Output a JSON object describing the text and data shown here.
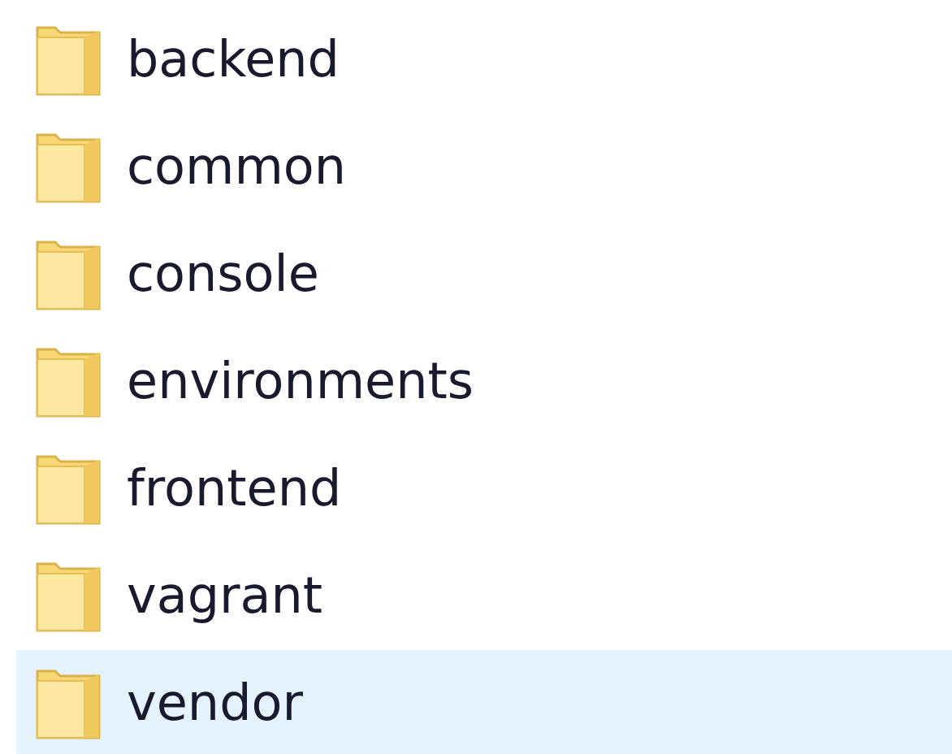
{
  "folders": [
    {
      "name": "backend",
      "selected": false
    },
    {
      "name": "common",
      "selected": false
    },
    {
      "name": "console",
      "selected": false
    },
    {
      "name": "environments",
      "selected": false
    },
    {
      "name": "frontend",
      "selected": false
    },
    {
      "name": "vagrant",
      "selected": false
    },
    {
      "name": "vendor",
      "selected": true
    }
  ]
}
